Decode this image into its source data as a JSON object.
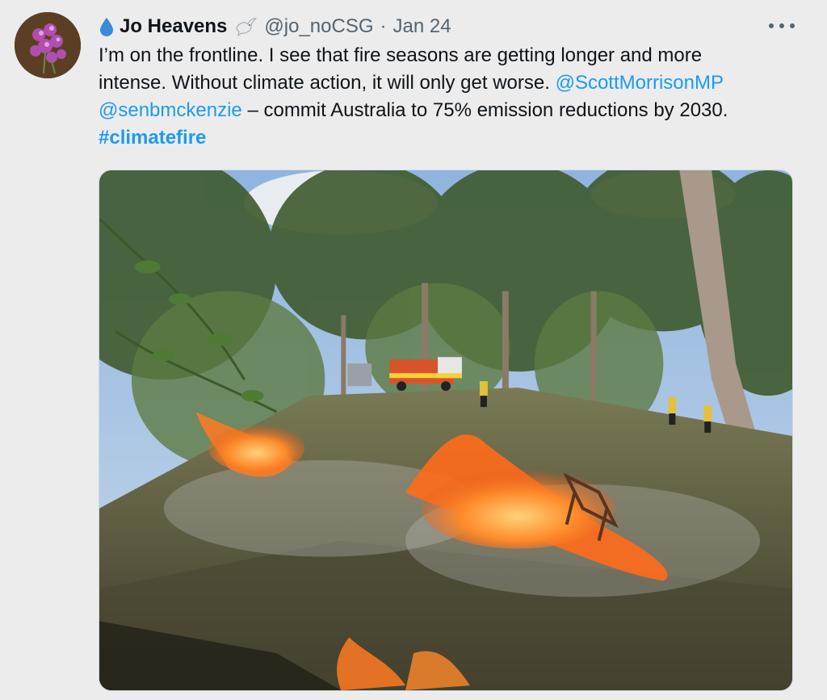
{
  "tweet": {
    "author": {
      "name": "Jo Heavens",
      "handle": "@jo_noCSG",
      "date": "Jan 24",
      "separator": "·",
      "name_prefix_icon": "water-drop-icon",
      "name_suffix_icon": "dove-icon"
    },
    "more_label": "···",
    "text": {
      "line1": "I’m on the frontline. I see that fire seasons are getting longer and more",
      "line2_prefix": "intense. Without climate action, it will only get worse. ",
      "mention1": "@ScottMorrisonMP",
      "mention2": "@senbmckenzie",
      "line3_suffix": " – commit Australia to 75% emission reductions by 2030.",
      "hashtag": "#climatefire"
    },
    "media": {
      "kind": "photo"
    },
    "colors": {
      "link": "#1d9bf0",
      "text": "#0f1419",
      "muted": "#536471",
      "background": "#ececec"
    }
  }
}
